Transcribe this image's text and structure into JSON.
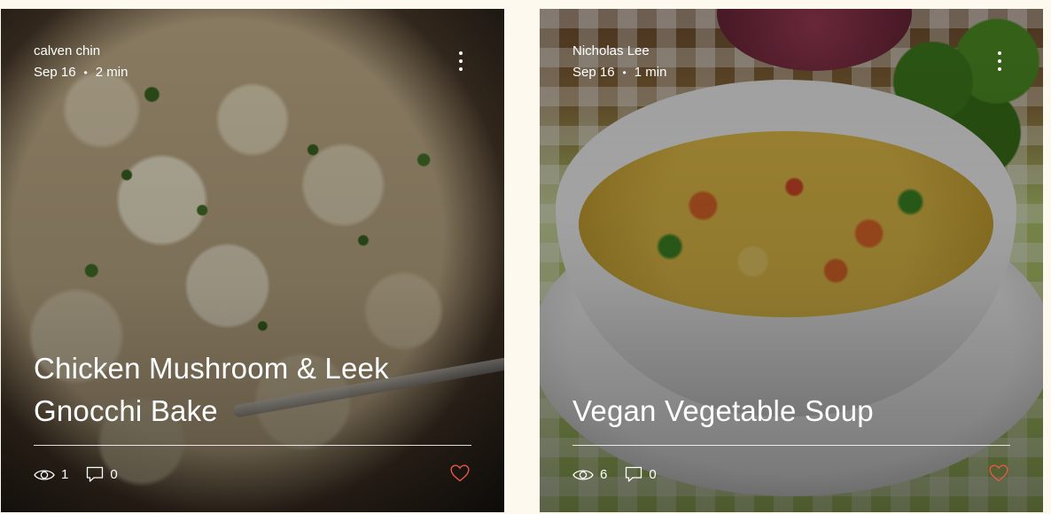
{
  "posts": [
    {
      "author": "calven chin",
      "date": "Sep 16",
      "separator": "•",
      "read_time": "2 min",
      "title": "Chicken Mushroom & Leek Gnocchi Bake",
      "views": "1",
      "comments": "0",
      "more_icon": "more-vertical-icon",
      "view_icon": "eye-icon",
      "comment_icon": "comment-icon",
      "like_icon": "heart-icon"
    },
    {
      "author": "Nicholas Lee",
      "date": "Sep 16",
      "separator": "•",
      "read_time": "1 min",
      "title": "Vegan Vegetable Soup",
      "views": "6",
      "comments": "0",
      "more_icon": "more-vertical-icon",
      "view_icon": "eye-icon",
      "comment_icon": "comment-icon",
      "like_icon": "heart-icon"
    }
  ],
  "colors": {
    "page_background": "#fdf9ef",
    "like_heart": "#e4574f",
    "text": "#ffffff"
  }
}
